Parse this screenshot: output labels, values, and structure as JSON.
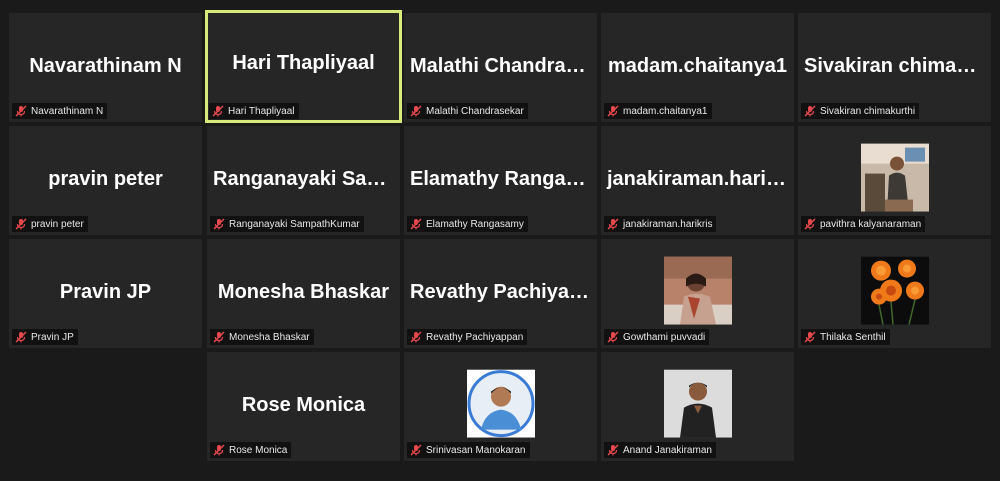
{
  "participants": [
    {
      "display": "Navarathinam N",
      "label": "Navarathinam N",
      "video": false,
      "active": false
    },
    {
      "display": "Hari Thapliyaal",
      "label": "Hari Thapliyaal",
      "video": false,
      "active": true
    },
    {
      "display": "Malathi Chandrasekar",
      "label": "Malathi Chandrasekar",
      "video": false,
      "active": false
    },
    {
      "display": "madam.chaitanya1",
      "label": "madam.chaitanya1",
      "video": false,
      "active": false
    },
    {
      "display": "Sivakiran chimakurthi",
      "label": "Sivakiran chimakurthi",
      "video": false,
      "active": false
    },
    {
      "display": "pravin peter",
      "label": "pravin peter",
      "video": false,
      "active": false
    },
    {
      "display": "Ranganayaki SampathKumar",
      "label": "Ranganayaki SampathKumar",
      "video": false,
      "active": false
    },
    {
      "display": "Elamathy Rangasamy",
      "label": "Elamathy Rangasamy",
      "video": false,
      "active": false
    },
    {
      "display": "janakiraman.harikris",
      "label": "janakiraman.harikris",
      "video": false,
      "active": false
    },
    {
      "display": "",
      "label": "pavithra kalyanaraman",
      "video": true,
      "active": false
    },
    {
      "display": "Pravin JP",
      "label": "Pravin JP",
      "video": false,
      "active": false
    },
    {
      "display": "Monesha Bhaskar",
      "label": "Monesha Bhaskar",
      "video": false,
      "active": false
    },
    {
      "display": "Revathy Pachiyappan",
      "label": "Revathy Pachiyappan",
      "video": false,
      "active": false
    },
    {
      "display": "",
      "label": "Gowthami puvvadi",
      "video": true,
      "active": false
    },
    {
      "display": "",
      "label": "Thilaka Senthil",
      "video": true,
      "active": false
    },
    {
      "display": "Rose Monica",
      "label": "Rose Monica",
      "video": false,
      "active": false
    },
    {
      "display": "",
      "label": "Srinivasan Manokaran",
      "video": true,
      "active": false
    },
    {
      "display": "",
      "label": "Anand Janakiraman",
      "video": true,
      "active": false
    }
  ],
  "colors": {
    "active_border": "#d7ea7a",
    "muted_icon": "#e5484d"
  },
  "icons": {
    "mic": "mic-muted-icon"
  }
}
